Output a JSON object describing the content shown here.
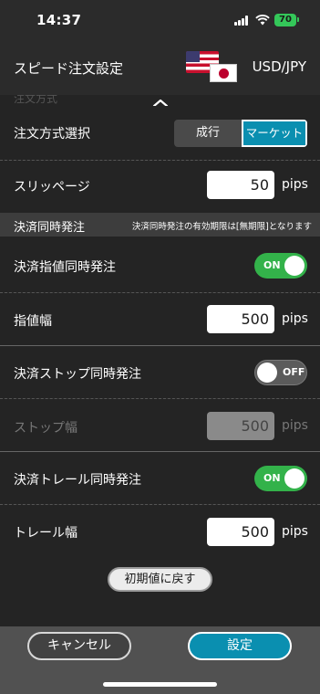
{
  "status": {
    "time": "14:37",
    "battery": "70"
  },
  "header": {
    "title": "スピード注文設定",
    "pair": "USD/JPY"
  },
  "stub": {
    "label": "注文方式"
  },
  "order_method": {
    "label": "注文方式選択",
    "option_left": "成行",
    "option_right": "マーケット",
    "selected": "マーケット"
  },
  "slippage": {
    "label": "スリッページ",
    "value": "50",
    "unit": "pips"
  },
  "section": {
    "title": "決済同時発注",
    "note": "決済同時発注の有効期限は[無期限]となります"
  },
  "limit_toggle": {
    "label": "決済指値同時発注",
    "state": "ON"
  },
  "limit_width": {
    "label": "指値幅",
    "value": "500",
    "unit": "pips"
  },
  "stop_toggle": {
    "label": "決済ストップ同時発注",
    "state": "OFF"
  },
  "stop_width": {
    "label": "ストップ幅",
    "value": "500",
    "unit": "pips"
  },
  "trail_toggle": {
    "label": "決済トレール同時発注",
    "state": "ON"
  },
  "trail_width": {
    "label": "トレール幅",
    "value": "500",
    "unit": "pips"
  },
  "reset_button": {
    "label": "初期値に戻す"
  },
  "footer": {
    "cancel": "キャンセル",
    "confirm": "設定"
  },
  "colors": {
    "accent": "#0a8fb0",
    "toggle_on": "#33b24a",
    "toggle_off": "#5b5b5b",
    "background": "#242424"
  }
}
